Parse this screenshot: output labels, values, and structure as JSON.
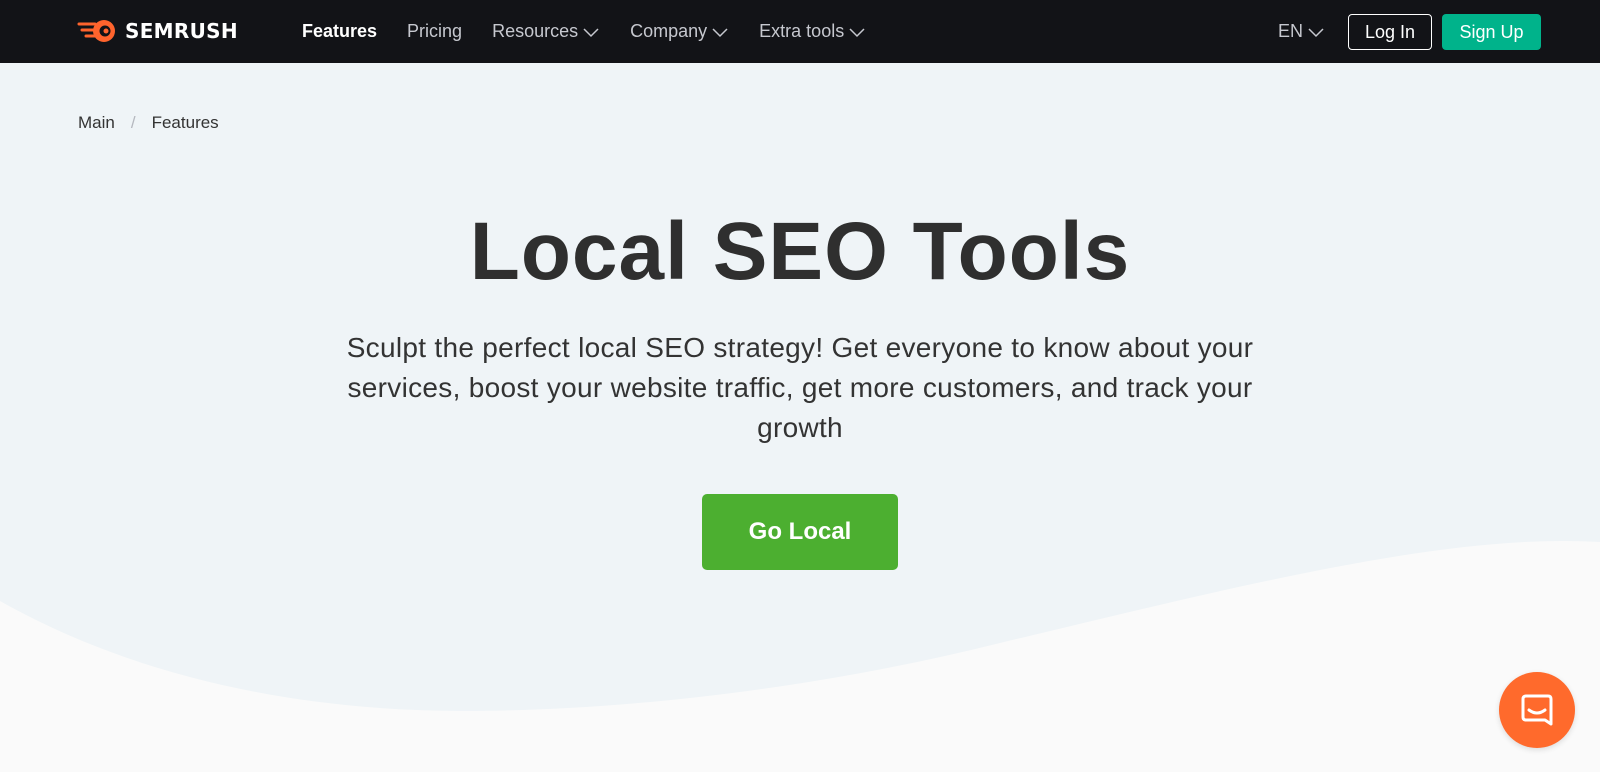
{
  "brand": {
    "name": "SEMRUSH",
    "logo_color": "#ff642d"
  },
  "nav": {
    "items": [
      {
        "label": "Features",
        "active": true,
        "dropdown": false
      },
      {
        "label": "Pricing",
        "active": false,
        "dropdown": false
      },
      {
        "label": "Resources",
        "active": false,
        "dropdown": true
      },
      {
        "label": "Company",
        "active": false,
        "dropdown": true
      },
      {
        "label": "Extra tools",
        "active": false,
        "dropdown": true
      }
    ],
    "language": "EN",
    "login_label": "Log In",
    "signup_label": "Sign Up"
  },
  "breadcrumb": {
    "items": [
      "Main",
      "Features"
    ],
    "separator": "/"
  },
  "hero": {
    "title": "Local SEO Tools",
    "subtitle": "Sculpt the perfect local SEO strategy! Get everyone to know about your services, boost your website traffic, get more customers, and track your growth",
    "cta_label": "Go Local"
  },
  "chat": {
    "icon": "chat-bubble-icon"
  },
  "colors": {
    "nav_bg": "#121317",
    "hero_bg": "#eff4f7",
    "lower_bg": "#fafafa",
    "signup": "#00b38b",
    "cta": "#4caf30",
    "chat": "#ff6a2c"
  }
}
